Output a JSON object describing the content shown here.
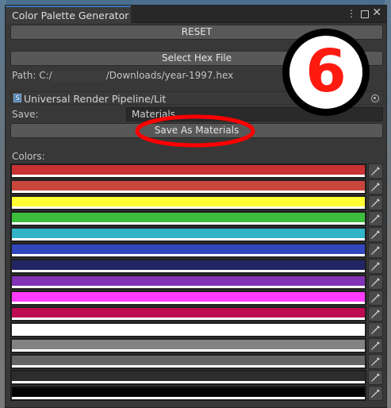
{
  "window": {
    "title": "Color Palette Generator",
    "menu_glyph": "⋮",
    "close_glyph": "✕"
  },
  "buttons": {
    "reset": "RESET",
    "select_hex": "Select Hex File",
    "save_materials": "Save As Materials"
  },
  "path": {
    "prefix": "Path: C:/",
    "suffix": "/Downloads/year-1997.hex"
  },
  "shader": {
    "icon_letter": "S",
    "label": "Universal Render Pipeline/Lit"
  },
  "save": {
    "label": "Save:",
    "value": "Materials"
  },
  "colors": {
    "label": "Colors:",
    "swatches": [
      "#c83232",
      "#c8463c",
      "#ffff32",
      "#3cbe3c",
      "#32b4c8",
      "#3246be",
      "#232464",
      "#8232b4",
      "#ff3cff",
      "#be0a50",
      "#ffffff",
      "#828282",
      "#646464",
      "#2d2d2d",
      "#050505"
    ]
  },
  "annotation": {
    "step_number": "6",
    "badge_color": "#ff1a10",
    "ellipse_color": "#ff0000"
  }
}
